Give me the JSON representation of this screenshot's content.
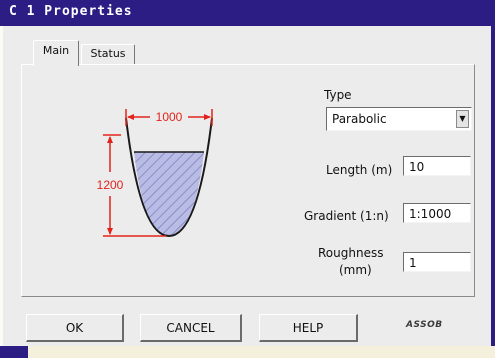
{
  "window": {
    "title": "C 1 Properties"
  },
  "tabs": [
    {
      "label": "Main",
      "active": true
    },
    {
      "label": "Status",
      "active": false
    }
  ],
  "diagram": {
    "width_label": "1000",
    "height_label": "1200",
    "dimension_color": "#e3231b",
    "fill_color": "#b9bce5"
  },
  "form": {
    "type_label": "Type",
    "type_value": "Parabolic",
    "length_label": "Length (m)",
    "length_value": "10",
    "gradient_label": "Gradient (1:n)",
    "gradient_value": "1:1000",
    "roughness_label_line1": "Roughness",
    "roughness_label_line2": "(mm)",
    "roughness_value": "1"
  },
  "buttons": {
    "ok": "OK",
    "cancel": "CANCEL",
    "help": "HELP"
  },
  "brand": "ASSOB"
}
